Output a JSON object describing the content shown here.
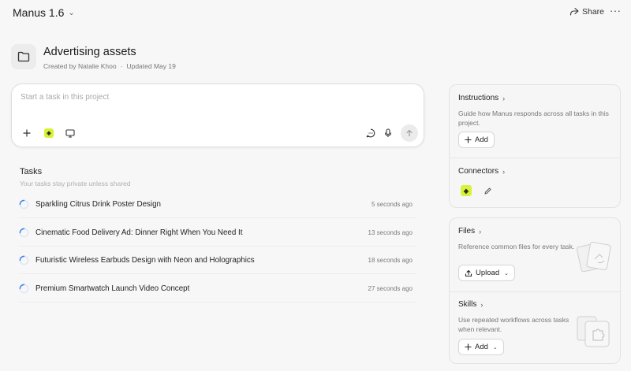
{
  "app": {
    "title": "Manus 1.6"
  },
  "header": {
    "share_label": "Share",
    "more_label": "···"
  },
  "project": {
    "title": "Advertising assets",
    "created_by": "Created by Natalie Khoo",
    "separator": "·",
    "updated": "Updated May 19"
  },
  "composer": {
    "placeholder": "Start a task in this project"
  },
  "tasks": {
    "title": "Tasks",
    "subtitle": "Your tasks stay private unless shared",
    "items": [
      {
        "title": "Sparkling Citrus Drink Poster Design",
        "time": "5 seconds ago"
      },
      {
        "title": "Cinematic Food Delivery Ad: Dinner Right When You Need It",
        "time": "13 seconds ago"
      },
      {
        "title": "Futuristic Wireless Earbuds Design with Neon and Holographics",
        "time": "18 seconds ago"
      },
      {
        "title": "Premium Smartwatch Launch Video Concept",
        "time": "27 seconds ago"
      }
    ]
  },
  "instructions": {
    "title": "Instructions",
    "description": "Guide how Manus responds across all tasks in this project.",
    "button": "Add"
  },
  "connectors": {
    "title": "Connectors"
  },
  "files": {
    "title": "Files",
    "description": "Reference common files for every task.",
    "button": "Upload"
  },
  "skills": {
    "title": "Skills",
    "description": "Use repeated workflows across tasks when relevant.",
    "button": "Add"
  },
  "colors": {
    "connector_badge": "#d8f23a",
    "spinner": "#3b82f6"
  }
}
